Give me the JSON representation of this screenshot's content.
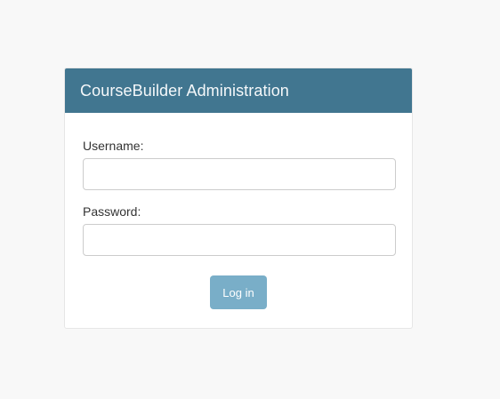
{
  "header": {
    "title": "CourseBuilder Administration"
  },
  "form": {
    "username_label": "Username:",
    "username_value": "",
    "password_label": "Password:",
    "password_value": "",
    "submit_label": "Log in"
  },
  "colors": {
    "header_bg": "#417690",
    "button_bg": "#79aec8",
    "page_bg": "#f8f8f8"
  }
}
